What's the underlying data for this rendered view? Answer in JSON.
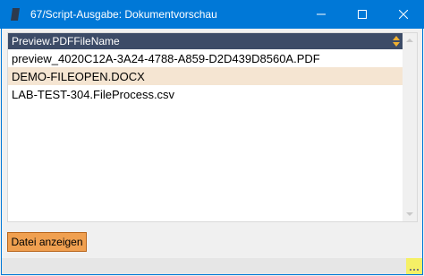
{
  "window": {
    "title": "67/Script-Ausgabe: Dokumentvorschau",
    "titlebar_color": "#0078d7",
    "icons": {
      "app": "document-icon",
      "minimize": "minimize-icon",
      "maximize": "maximize-icon",
      "close": "close-icon"
    }
  },
  "grid": {
    "columns": [
      {
        "header": "Preview.PDFFileName",
        "sort_icon": "sort-icon"
      }
    ],
    "header_color": "#3c4b67",
    "selected_color": "#f5e5d2",
    "rows": [
      {
        "file": "preview_4020C12A-3A24-4788-A859-D2D439D8560A.PDF",
        "selected": false
      },
      {
        "file": "DEMO-FILEOPEN.DOCX",
        "selected": true
      },
      {
        "file": "LAB-TEST-304.FileProcess.csv",
        "selected": false
      }
    ]
  },
  "actions": {
    "show_file_label": "Datei anzeigen",
    "button_color": "#f0a050"
  },
  "statusbar": {
    "grip_icon": "resize-grip-icon",
    "grip_color": "#f5f066"
  }
}
